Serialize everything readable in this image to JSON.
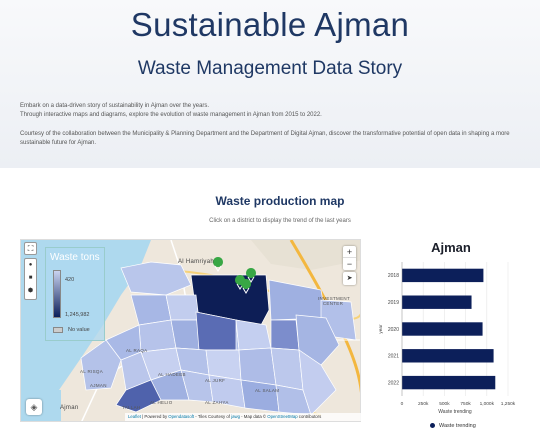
{
  "header": {
    "title": "Sustainable Ajman",
    "subtitle": "Waste Management Data Story",
    "intro": [
      "Embark on a data-driven story of sustainability in Ajman over the years.",
      "Through interactive maps and diagrams, explore the evolution of waste management in Ajman from 2015 to 2022."
    ],
    "courtesy": "Courtesy of the collaboration between the Municipality & Planning Department and the Department of Digital Ajman, discover the transformative potential of open data in shaping a more sustainable future for Ajman."
  },
  "map_section": {
    "title": "Waste production map",
    "instruction": "Click on a district to display the trend of the last years",
    "legend": {
      "title": "Waste tons",
      "min": "420",
      "max": "1,245,982",
      "no_value": "No value",
      "color_low": "#c9d3f0",
      "color_high": "#0c1f5a",
      "color_none": "#cccccc"
    },
    "controls": {
      "zoom_in": "+",
      "zoom_out": "−",
      "fullscreen": "⛶",
      "locate": "➤"
    },
    "place_labels": {
      "al_hamriyah": "Al Hamriyah",
      "investment_center": "INVESTMENT CENTER",
      "al_raqa": "AL RAQA",
      "al_risqa": "AL RISQA",
      "al_hadeeb": "AL HADEEB",
      "ajman": "AJMAN",
      "al_jurf": "AL JURF",
      "ajman_city": "Ajman",
      "al_helio": "AL HELIO",
      "al_zahya": "AL ZAHYA",
      "al_salam": "AL SALAM",
      "tallah": "TALLAH"
    },
    "attribution": {
      "leaflet": "Leaflet",
      "powered": " | Powered by ",
      "ods": "Opendatasoft",
      "tiles": " - Tiles Courtesy of ",
      "jawg": "jawg",
      "mapdata": " - Map data © ",
      "osm": "OpenStreetMap",
      "contributors": " contributors"
    }
  },
  "chart_data": {
    "type": "bar",
    "orientation": "horizontal",
    "title": "Ajman",
    "categories": [
      "2018",
      "2019",
      "2020",
      "2021",
      "2022"
    ],
    "series": [
      {
        "name": "Waste trending",
        "values": [
          960000,
          820000,
          950000,
          1080000,
          1100000
        ]
      }
    ],
    "xlabel": "Waste trending",
    "ylabel": "year",
    "xlim": [
      0,
      1250000
    ],
    "xticks": [
      "0",
      "250k",
      "500k",
      "750k",
      "1,000k",
      "1,250k"
    ],
    "grid": true,
    "legend_position": "bottom",
    "color": "#0c1f5a"
  }
}
